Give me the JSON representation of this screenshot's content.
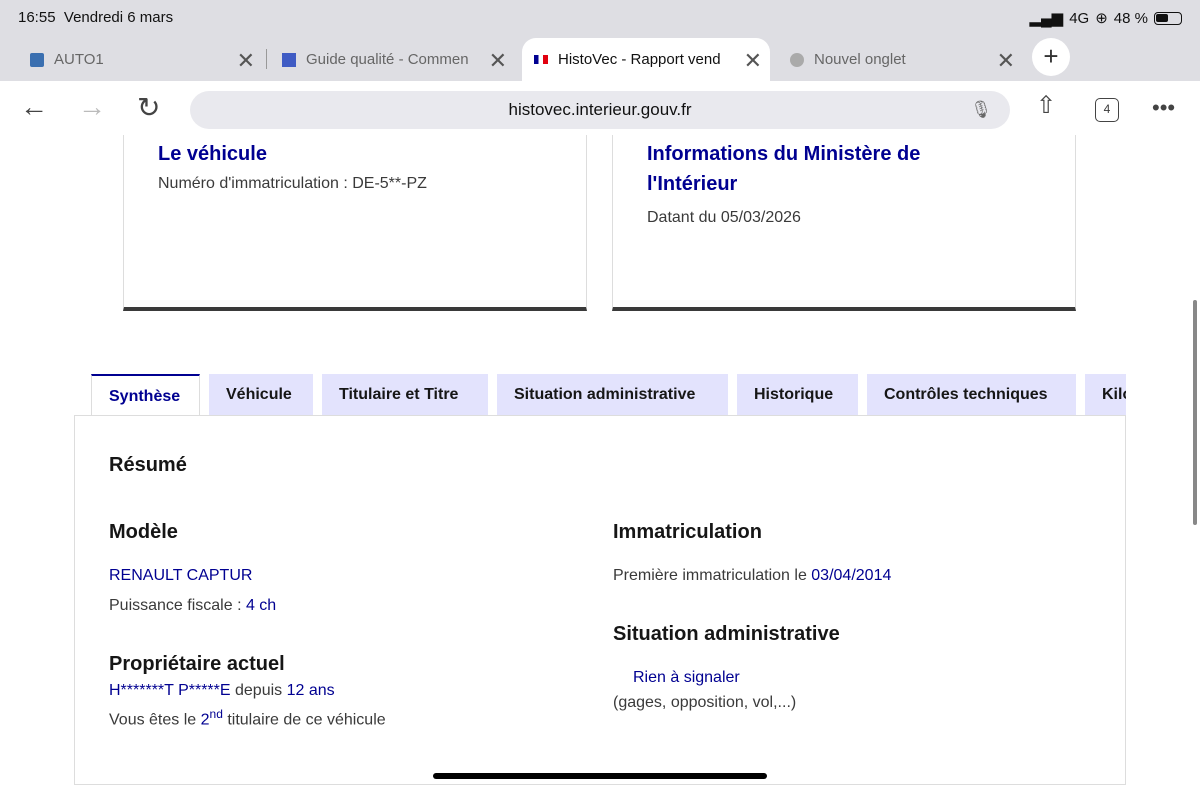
{
  "status": {
    "time": "16:55",
    "date": "Vendredi 6 mars",
    "network": "4G",
    "battery": "48 %"
  },
  "browser_tabs": [
    {
      "title": "AUTO1"
    },
    {
      "title": "Guide qualité - Commen"
    },
    {
      "title": "HistoVec - Rapport vend",
      "active": true
    },
    {
      "title": "Nouvel onglet"
    }
  ],
  "url": "histovec.interieur.gouv.fr",
  "tab_count": "4",
  "cards": {
    "vehicule": {
      "title": "Le véhicule",
      "text": "Numéro d'immatriculation : DE-5**-PZ"
    },
    "ministere": {
      "title": "Informations du Ministère de l'Intérieur",
      "text": "Datant du 05/03/2026"
    }
  },
  "tabs": [
    "Synthèse",
    "Véhicule",
    "Titulaire et Titre",
    "Situation administrative",
    "Historique",
    "Contrôles techniques",
    "Kilométrage"
  ],
  "summary": {
    "title": "Résumé",
    "modele": {
      "heading": "Modèle",
      "name": "RENAULT CAPTUR",
      "puissance_label": "Puissance fiscale : ",
      "puissance": "4 ch"
    },
    "proprietaire": {
      "heading": "Propriétaire actuel",
      "name": "H*******T P*****E",
      "depuis": " depuis ",
      "duree": "12 ans",
      "rank_pre": "Vous êtes le ",
      "rank": "2",
      "rank_sup": "nd",
      "rank_post": " titulaire de ce véhicule"
    },
    "immatriculation": {
      "heading": "Immatriculation",
      "label": "Première immatriculation le ",
      "date": "03/04/2014"
    },
    "situation": {
      "heading": "Situation administrative",
      "status": "Rien à signaler",
      "detail": "(gages, opposition, vol,...)"
    }
  },
  "colors": {
    "accent": "#000091",
    "tab_bg": "#e3e3fd"
  }
}
